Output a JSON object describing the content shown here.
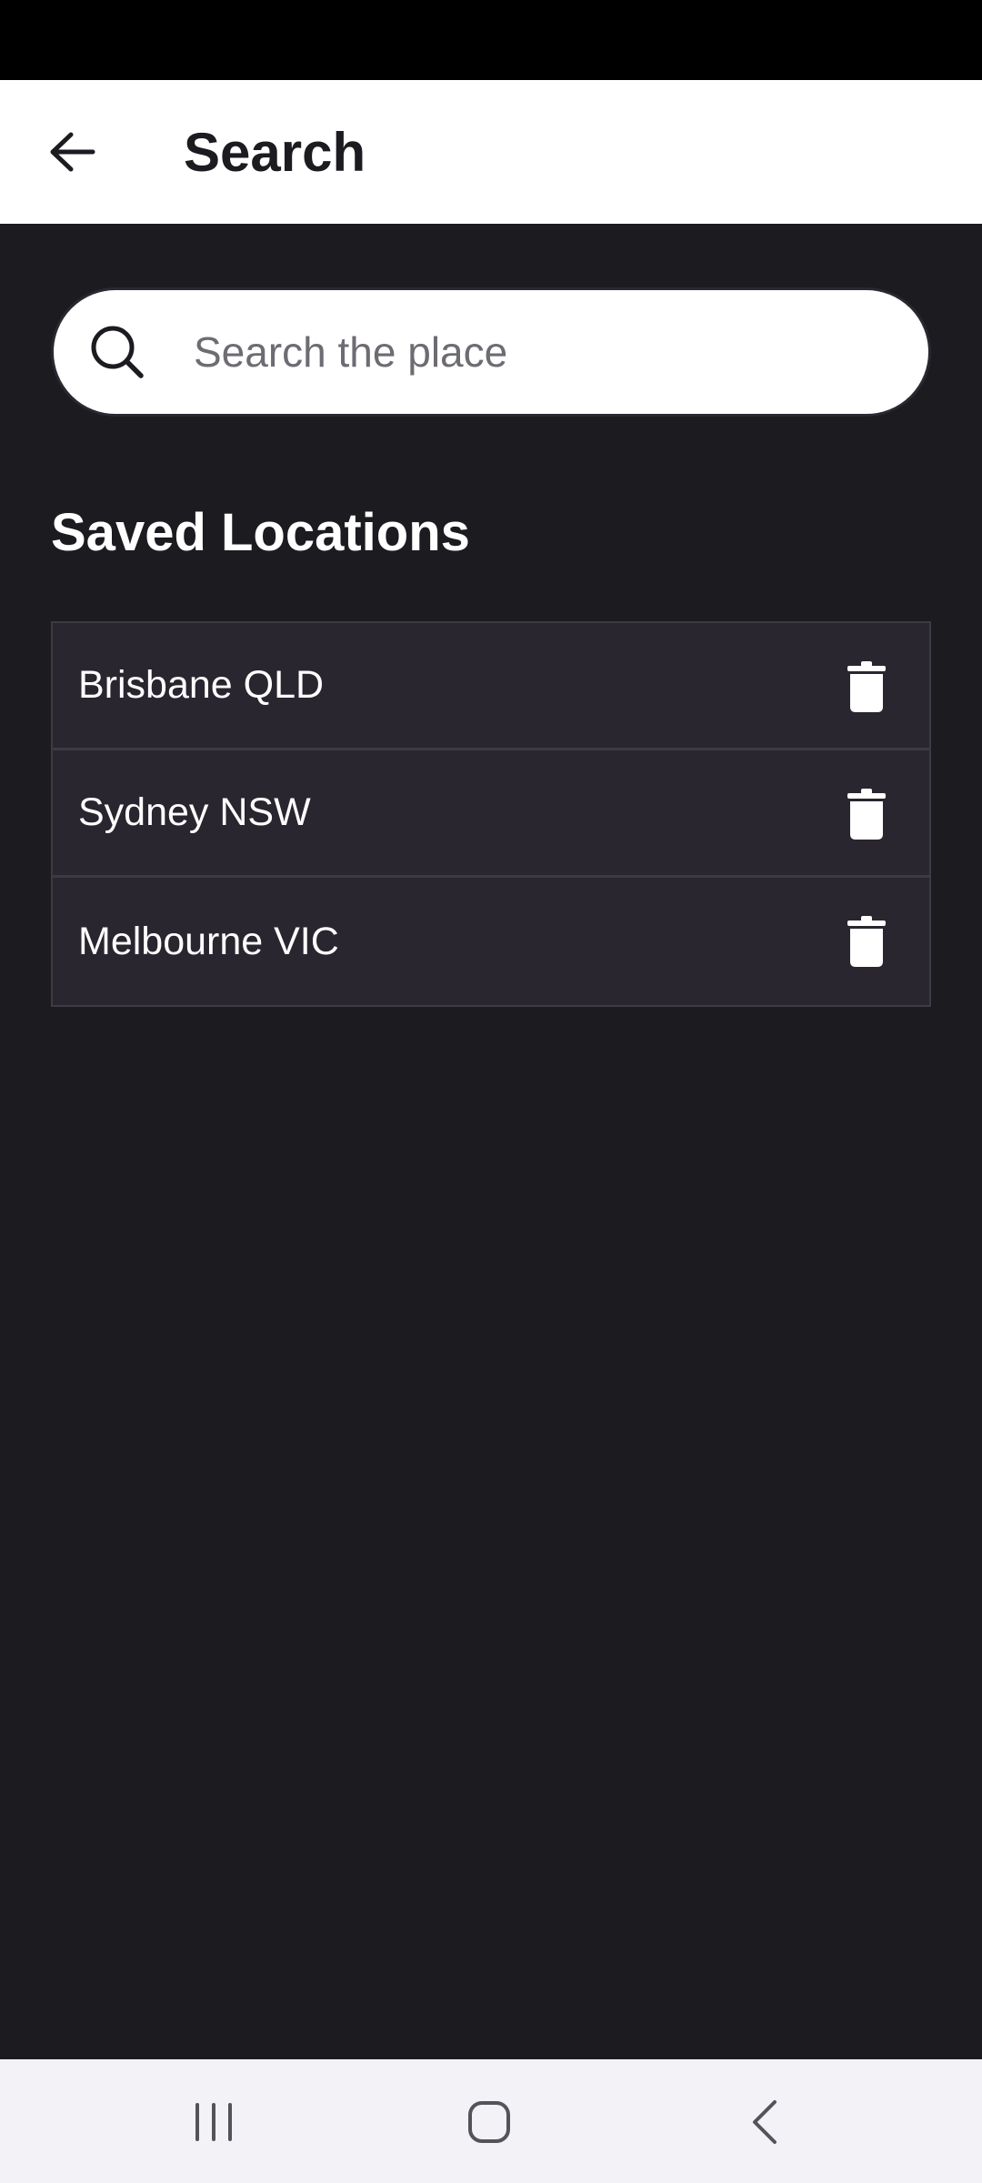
{
  "header": {
    "title": "Search"
  },
  "search": {
    "placeholder": "Search the place",
    "value": ""
  },
  "saved": {
    "title": "Saved Locations",
    "items": [
      {
        "label": "Brisbane QLD"
      },
      {
        "label": "Sydney NSW"
      },
      {
        "label": "Melbourne VIC"
      }
    ]
  },
  "icons": {
    "back": "arrow-left-icon",
    "search": "search-icon",
    "delete": "trash-icon",
    "nav_recents": "recents-icon",
    "nav_home": "home-icon",
    "nav_back": "back-chevron-icon"
  },
  "colors": {
    "background": "#1c1b20",
    "app_bar": "#ffffff",
    "list_item": "#29262f",
    "nav_bar": "#f3f2f7"
  }
}
